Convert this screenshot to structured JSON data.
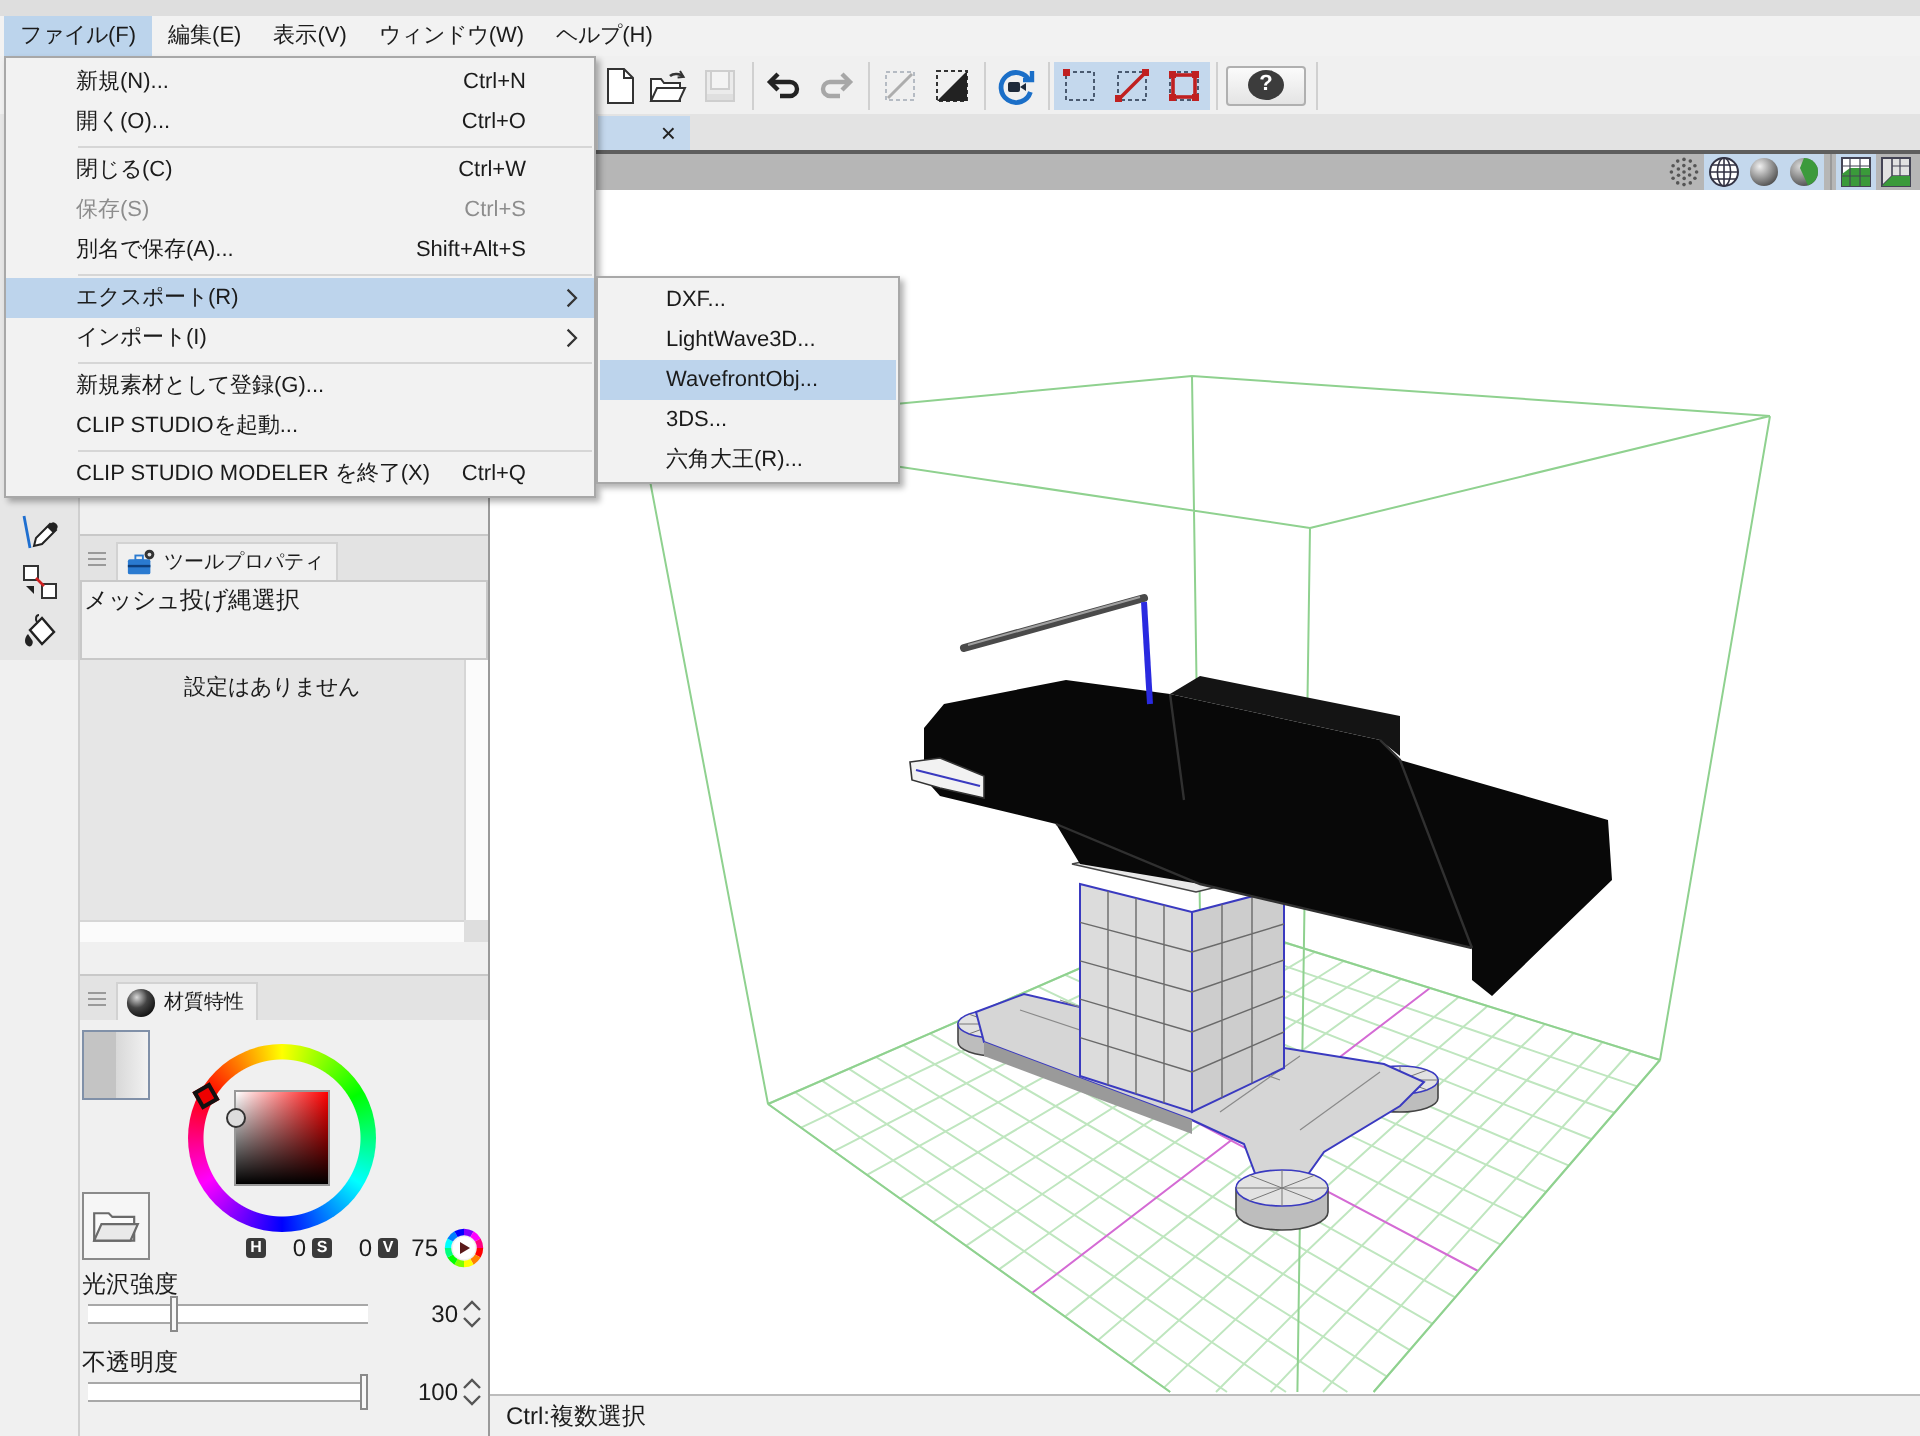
{
  "menu_bar": [
    {
      "label": "ファイル(F)",
      "selected": true
    },
    {
      "label": "編集(E)",
      "selected": false
    },
    {
      "label": "表示(V)",
      "selected": false
    },
    {
      "label": "ウィンドウ(W)",
      "selected": false
    },
    {
      "label": "ヘルプ(H)",
      "selected": false
    }
  ],
  "file_menu": [
    {
      "kind": "item",
      "label": "新規(N)...",
      "shortcut": "Ctrl+N",
      "selected": false,
      "disabled": false,
      "submenu": false
    },
    {
      "kind": "item",
      "label": "開く(O)...",
      "shortcut": "Ctrl+O",
      "selected": false,
      "disabled": false,
      "submenu": false
    },
    {
      "kind": "separator"
    },
    {
      "kind": "item",
      "label": "閉じる(C)",
      "shortcut": "Ctrl+W",
      "selected": false,
      "disabled": false,
      "submenu": false
    },
    {
      "kind": "item",
      "label": "保存(S)",
      "shortcut": "Ctrl+S",
      "selected": false,
      "disabled": true,
      "submenu": false
    },
    {
      "kind": "item",
      "label": "別名で保存(A)...",
      "shortcut": "Shift+Alt+S",
      "selected": false,
      "disabled": false,
      "submenu": false
    },
    {
      "kind": "separator"
    },
    {
      "kind": "item",
      "label": "エクスポート(R)",
      "selected": true,
      "disabled": false,
      "submenu": true
    },
    {
      "kind": "item",
      "label": "インポート(I)",
      "selected": false,
      "disabled": false,
      "submenu": true
    },
    {
      "kind": "separator"
    },
    {
      "kind": "item",
      "label": "新規素材として登録(G)...",
      "selected": false,
      "disabled": false,
      "submenu": false
    },
    {
      "kind": "item",
      "label": "CLIP STUDIOを起動...",
      "selected": false,
      "disabled": false,
      "submenu": false
    },
    {
      "kind": "separator"
    },
    {
      "kind": "item",
      "label": "CLIP STUDIO MODELER を終了(X)",
      "shortcut": "Ctrl+Q",
      "selected": false,
      "disabled": false,
      "submenu": false
    }
  ],
  "export_submenu": [
    {
      "label": "DXF...",
      "selected": false
    },
    {
      "label": "LightWave3D...",
      "selected": false
    },
    {
      "label": "WavefrontObj...",
      "selected": true
    },
    {
      "label": "3DS...",
      "selected": false
    },
    {
      "label": "六角大王(R)...",
      "selected": false
    }
  ],
  "toolbar": [
    {
      "kind": "new",
      "selected": false,
      "disabled": false
    },
    {
      "kind": "open",
      "selected": false,
      "disabled": false
    },
    {
      "kind": "save",
      "selected": false,
      "disabled": true
    },
    {
      "kind": "separator"
    },
    {
      "kind": "undo",
      "selected": false,
      "disabled": false
    },
    {
      "kind": "redo",
      "selected": false,
      "disabled": true
    },
    {
      "kind": "separator"
    },
    {
      "kind": "deselect",
      "selected": false,
      "disabled": true
    },
    {
      "kind": "invert-selection",
      "selected": false,
      "disabled": false
    },
    {
      "kind": "separator"
    },
    {
      "kind": "camera",
      "selected": false,
      "disabled": false
    },
    {
      "kind": "separator"
    },
    {
      "kind": "vertex-mode",
      "selected": true,
      "disabled": false
    },
    {
      "kind": "edge-mode",
      "selected": true,
      "disabled": false
    },
    {
      "kind": "face-mode",
      "selected": true,
      "disabled": false
    },
    {
      "kind": "separator"
    },
    {
      "kind": "help",
      "glyph": "?"
    },
    {
      "kind": "separator"
    }
  ],
  "document_tab": {
    "close": "×",
    "selected": true
  },
  "viewport": {
    "display_toggles": [
      {
        "kind": "vertices",
        "selected": false
      },
      {
        "kind": "wireframe",
        "selected": true
      },
      {
        "kind": "shaded",
        "selected": true
      },
      {
        "kind": "textured",
        "selected": true
      },
      {
        "kind": "separator"
      },
      {
        "kind": "floor-grid",
        "selected": true
      },
      {
        "kind": "wall-grid",
        "selected": false
      }
    ]
  },
  "tool_property": {
    "tab": "ツールプロパティ",
    "tool_name": "メッシュ投げ縄選択",
    "message": "設定はありません"
  },
  "material": {
    "tab": "材質特性",
    "hsv": [
      {
        "key": "H",
        "value": "0"
      },
      {
        "key": "S",
        "value": "0"
      },
      {
        "key": "V",
        "value": "75"
      }
    ],
    "sliders": [
      {
        "label": "光沢強度",
        "level": 0.3,
        "value": "30"
      },
      {
        "label": "不透明度",
        "level": 1,
        "value": "100"
      }
    ]
  },
  "status_bar": {
    "text": "Ctrl:複数選択"
  }
}
